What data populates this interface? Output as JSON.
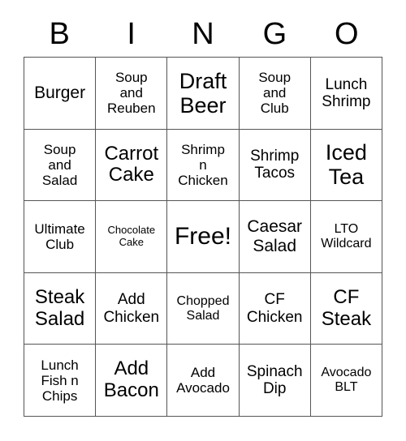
{
  "card": {
    "header_letters": [
      "B",
      "I",
      "N",
      "G",
      "O"
    ],
    "rows": [
      [
        {
          "text": "Burger",
          "size": "fs-xl"
        },
        {
          "text": "Soup\nand\nReuben",
          "size": "fs-md"
        },
        {
          "text": "Draft\nBeer",
          "size": "fs-3xl"
        },
        {
          "text": "Soup\nand\nClub",
          "size": "fs-md"
        },
        {
          "text": "Lunch\nShrimp",
          "size": "fs-lg"
        }
      ],
      [
        {
          "text": "Soup\nand\nSalad",
          "size": "fs-md"
        },
        {
          "text": "Carrot\nCake",
          "size": "fs-2xl"
        },
        {
          "text": "Shrimp\nn\nChicken",
          "size": "fs-md"
        },
        {
          "text": "Shrimp\nTacos",
          "size": "fs-lg"
        },
        {
          "text": "Iced\nTea",
          "size": "fs-3xl"
        }
      ],
      [
        {
          "text": "Ultimate\nClub",
          "size": "fs-md"
        },
        {
          "text": "Chocolate\nCake",
          "size": "fs-xs"
        },
        {
          "text": "Free!",
          "size": "fs-4xl"
        },
        {
          "text": "Caesar\nSalad",
          "size": "fs-xl"
        },
        {
          "text": "LTO\nWildcard",
          "size": "fs-sm"
        }
      ],
      [
        {
          "text": "Steak\nSalad",
          "size": "fs-2xl"
        },
        {
          "text": "Add\nChicken",
          "size": "fs-lg"
        },
        {
          "text": "Chopped\nSalad",
          "size": "fs-sm"
        },
        {
          "text": "CF\nChicken",
          "size": "fs-lg"
        },
        {
          "text": "CF\nSteak",
          "size": "fs-2xl"
        }
      ],
      [
        {
          "text": "Lunch\nFish n\nChips",
          "size": "fs-md"
        },
        {
          "text": "Add\nBacon",
          "size": "fs-2xl"
        },
        {
          "text": "Add\nAvocado",
          "size": "fs-md"
        },
        {
          "text": "Spinach\nDip",
          "size": "fs-lg"
        },
        {
          "text": "Avocado\nBLT",
          "size": "fs-sm"
        }
      ]
    ]
  },
  "colors": {
    "border": "#555555",
    "background": "#ffffff",
    "text": "#000000"
  }
}
